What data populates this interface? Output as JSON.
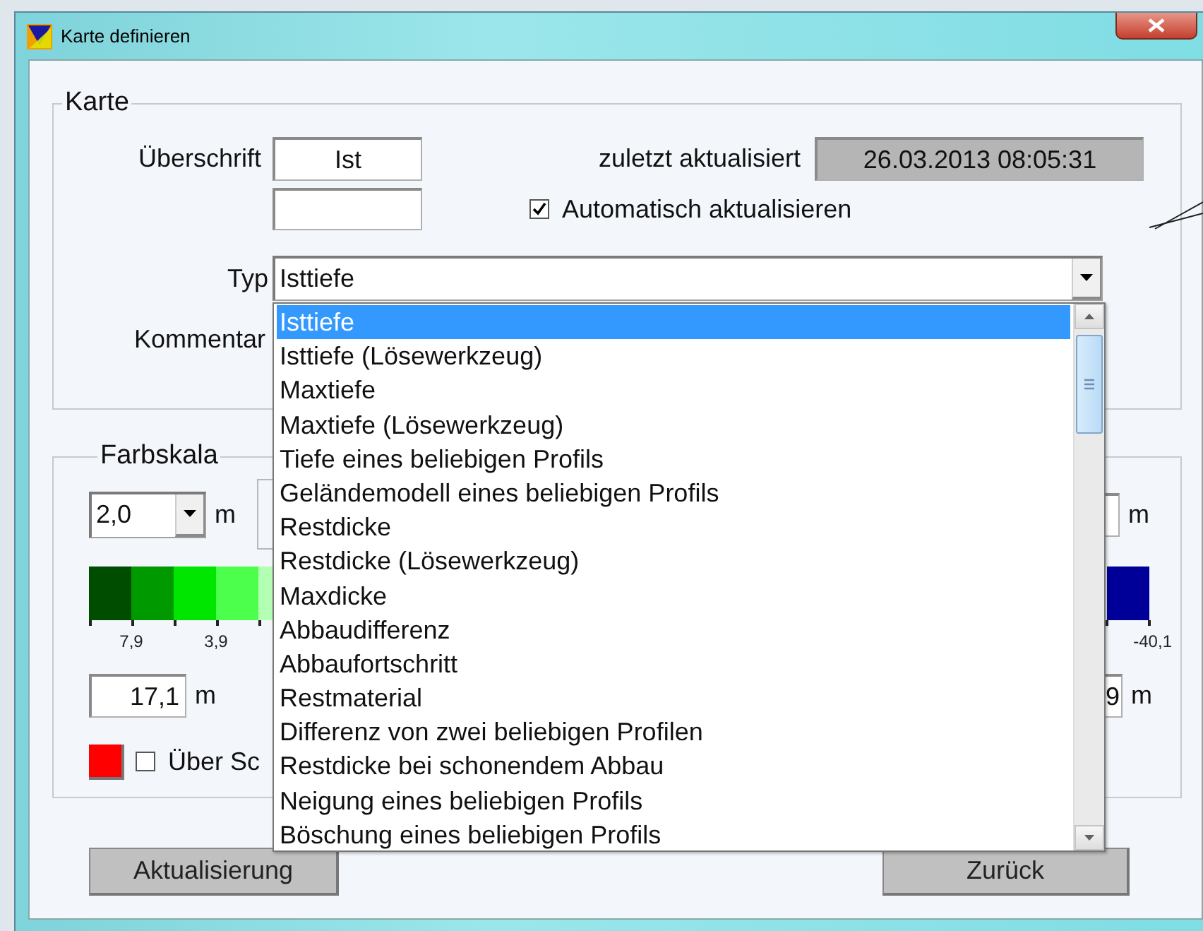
{
  "window": {
    "title": "Karte definieren"
  },
  "karte": {
    "legend": "Karte",
    "heading_label": "Überschrift",
    "heading_value": "Ist",
    "updated_label": "zuletzt aktualisiert",
    "updated_value": "26.03.2013 08:05:31",
    "auto_update": {
      "label": "Automatisch aktualisieren",
      "checked": true
    },
    "type": {
      "label": "Typ",
      "value": "Isttiefe"
    },
    "comment_label": "Kommentar"
  },
  "type_list": [
    {
      "label": "Isttiefe",
      "selected": true
    },
    {
      "label": "Isttiefe (Lösewerkzeug)",
      "selected": false
    },
    {
      "label": "Maxtiefe",
      "selected": false
    },
    {
      "label": "Maxtiefe (Lösewerkzeug)",
      "selected": false
    },
    {
      "label": "Tiefe eines beliebigen Profils",
      "selected": false
    },
    {
      "label": "Geländemodell eines beliebigen Profils",
      "selected": false
    },
    {
      "label": "Restdicke",
      "selected": false
    },
    {
      "label": "Restdicke (Lösewerkzeug)",
      "selected": false
    },
    {
      "label": "Maxdicke",
      "selected": false
    },
    {
      "label": "Abbaudifferenz",
      "selected": false
    },
    {
      "label": "Abbaufortschritt",
      "selected": false
    },
    {
      "label": "Restmaterial",
      "selected": false
    },
    {
      "label": "Differenz von zwei beliebigen Profilen",
      "selected": false
    },
    {
      "label": "Restdicke bei schonendem Abbau",
      "selected": false
    },
    {
      "label": "Neigung eines beliebigen Profils",
      "selected": false
    },
    {
      "label": "Böschung eines beliebigen Profils",
      "selected": false
    }
  ],
  "farbskala": {
    "legend": "Farbskala",
    "step": {
      "value": "2,0",
      "unit": "m"
    },
    "right_unit": "m",
    "left_colors": [
      {
        "color": "#004d00"
      },
      {
        "color": "#009900"
      },
      {
        "color": "#00e600"
      },
      {
        "color": "#4dff4d"
      },
      {
        "color": "#b3ffb3"
      }
    ],
    "right_colors": [
      {
        "color": "#000099"
      }
    ],
    "left_labels": [
      "7,9",
      "3,9"
    ],
    "right_labels": [
      "-40,1"
    ],
    "min": {
      "value": "17,1",
      "unit": "m"
    },
    "max": {
      "value": "9",
      "unit": "m"
    },
    "overflow": {
      "color": "#ff0000",
      "checked": false,
      "label": "Über Sc"
    }
  },
  "buttons": [
    {
      "label": "Aktualisierung"
    },
    {
      "label": "Zurück"
    }
  ]
}
